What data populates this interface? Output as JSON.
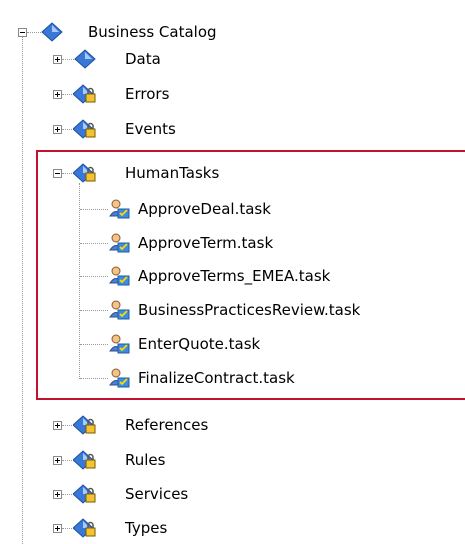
{
  "tree": {
    "root": {
      "label": "Business Catalog",
      "expanded": true
    },
    "folders_top": [
      {
        "label": "Data",
        "icon": "diamond-icon"
      },
      {
        "label": "Errors",
        "icon": "locked-diamond-icon"
      },
      {
        "label": "Events",
        "icon": "locked-diamond-icon"
      }
    ],
    "human_tasks": {
      "label": "HumanTasks",
      "expanded": true,
      "children": [
        "ApproveDeal.task",
        "ApproveTerm.task",
        "ApproveTerms_EMEA.task",
        "BusinessPracticesReview.task",
        "EnterQuote.task",
        "FinalizeContract.task"
      ]
    },
    "folders_bottom": [
      {
        "label": "References",
        "icon": "locked-diamond-icon"
      },
      {
        "label": "Rules",
        "icon": "locked-diamond-icon"
      },
      {
        "label": "Services",
        "icon": "locked-diamond-icon"
      },
      {
        "label": "Types",
        "icon": "locked-diamond-icon"
      }
    ]
  },
  "colors": {
    "highlight_border": "#c4112f",
    "tree_lines": "#999999",
    "icon_blue": "#3a78d8"
  }
}
